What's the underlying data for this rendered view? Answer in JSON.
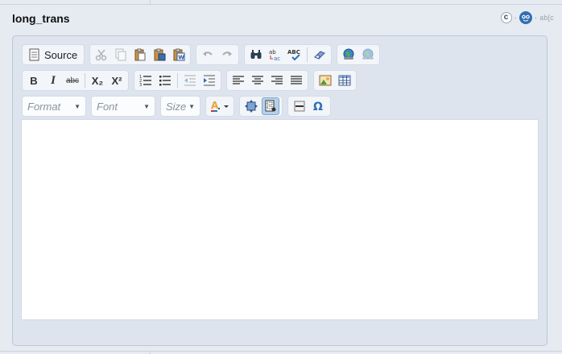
{
  "field": {
    "title": "long_trans",
    "c_label": "c",
    "separator": "·",
    "abc_label": "ab[c"
  },
  "toolbar": {
    "source_label": "Source",
    "bold_label": "B",
    "italic_label": "I",
    "strike_label": "abc",
    "subscript_label": "X₂",
    "superscript_label": "X²",
    "format_label": "Format",
    "font_label": "Font",
    "size_label": "Size"
  },
  "icons": {
    "source": "document-icon",
    "cut": "scissors-icon",
    "copy": "copy-icon",
    "paste": "paste-icon",
    "paste_text": "paste-text-icon",
    "paste_word": "paste-word-icon",
    "undo": "undo-icon",
    "redo": "redo-icon",
    "find": "binoculars-icon",
    "replace": "replace-icon",
    "spellcheck": "spellcheck-icon",
    "remove_format": "eraser-icon",
    "link": "link-globe-icon",
    "unlink": "unlink-globe-icon",
    "ordered_list": "ordered-list-icon",
    "bullet_list": "bullet-list-icon",
    "outdent": "outdent-icon",
    "indent": "indent-icon",
    "align_left": "align-left-icon",
    "align_center": "align-center-icon",
    "align_right": "align-right-icon",
    "justify": "justify-icon",
    "image": "image-icon",
    "table": "table-icon",
    "text_color": "text-color-icon",
    "maximize": "maximize-icon",
    "show_blocks": "show-blocks-icon",
    "horizontal_rule": "horizontal-rule-icon",
    "special_char": "omega-icon"
  },
  "colors": {
    "accent": "#2f6fb5",
    "active_button": "#b7d0ea",
    "editor_background": "#ffffff"
  },
  "state": {
    "active_button": "show_blocks"
  }
}
